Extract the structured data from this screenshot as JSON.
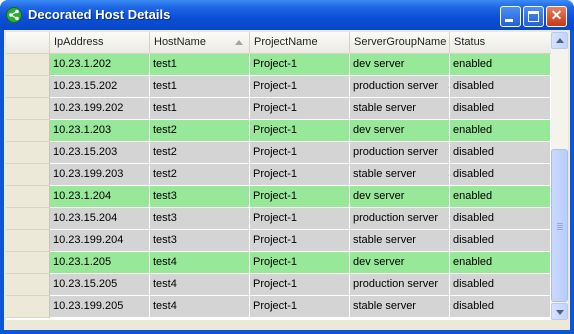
{
  "window": {
    "title": "Decorated Host Details",
    "icon": "share-icon",
    "controls": [
      "minimize-icon",
      "maximize-icon",
      "close-icon"
    ]
  },
  "grid": {
    "columns": [
      "IpAddress",
      "HostName",
      "ProjectName",
      "ServerGroupName",
      "Status"
    ],
    "sorted_column": "HostName",
    "sort_direction": "ascending",
    "highlight_color": "#98e89a",
    "normal_color": "#d4d4d4",
    "rows": [
      {
        "ip": "10.23.1.202",
        "host": "test1",
        "project": "Project-1",
        "group": "dev server",
        "status": "enabled",
        "highlight": true
      },
      {
        "ip": "10.23.15.202",
        "host": "test1",
        "project": "Project-1",
        "group": "production server",
        "status": "disabled",
        "highlight": false
      },
      {
        "ip": "10.23.199.202",
        "host": "test1",
        "project": "Project-1",
        "group": "stable server",
        "status": "disabled",
        "highlight": false
      },
      {
        "ip": "10.23.1.203",
        "host": "test2",
        "project": "Project-1",
        "group": "dev server",
        "status": "enabled",
        "highlight": true
      },
      {
        "ip": "10.23.15.203",
        "host": "test2",
        "project": "Project-1",
        "group": "production server",
        "status": "disabled",
        "highlight": false
      },
      {
        "ip": "10.23.199.203",
        "host": "test2",
        "project": "Project-1",
        "group": "stable server",
        "status": "disabled",
        "highlight": false
      },
      {
        "ip": "10.23.1.204",
        "host": "test3",
        "project": "Project-1",
        "group": "dev server",
        "status": "enabled",
        "highlight": true
      },
      {
        "ip": "10.23.15.204",
        "host": "test3",
        "project": "Project-1",
        "group": "production server",
        "status": "disabled",
        "highlight": false
      },
      {
        "ip": "10.23.199.204",
        "host": "test3",
        "project": "Project-1",
        "group": "stable server",
        "status": "disabled",
        "highlight": false
      },
      {
        "ip": "10.23.1.205",
        "host": "test4",
        "project": "Project-1",
        "group": "dev server",
        "status": "enabled",
        "highlight": true
      },
      {
        "ip": "10.23.15.205",
        "host": "test4",
        "project": "Project-1",
        "group": "production server",
        "status": "disabled",
        "highlight": false
      },
      {
        "ip": "10.23.199.205",
        "host": "test4",
        "project": "Project-1",
        "group": "stable server",
        "status": "disabled",
        "highlight": false
      }
    ]
  }
}
